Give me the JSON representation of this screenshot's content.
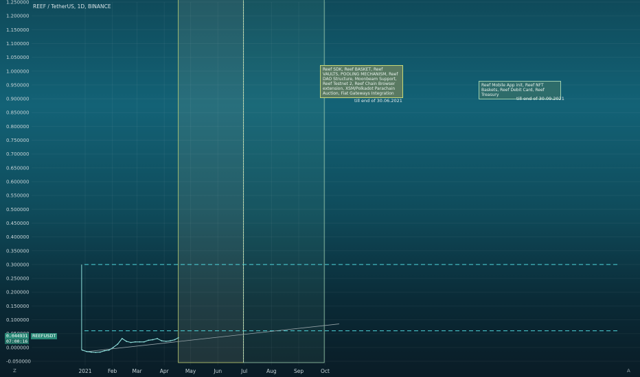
{
  "header": {
    "title": "REEF / TetherUS, 1D, BINANCE"
  },
  "price_tag": {
    "price": "0.044931",
    "countdown": "07:00:16",
    "symbol": "REEFUSDT"
  },
  "controls": {
    "left_corner": "Z",
    "right_corner": "A"
  },
  "annotations": [
    {
      "text": "Reef SDK, Reef BASKET, Reef VAULTS, POOLING MECHANISM, Reef DAO Structure, Moonbeam Support, Reef Testnet 2, Reef Chain Browser extension, XSM/Polkadot Parachain Auction, Fiat Gateways Integration",
      "caption": "till end of 30.06.2021"
    },
    {
      "text": "Reef Mobile App init, Reef NFT Baskets, Reef Debit Card, Reef Treasury",
      "caption": "till end of 30.09.2021"
    }
  ],
  "colors": {
    "zone1_border": "#c8d878",
    "zone2_border": "#9ed0b0",
    "dashed_line": "#4fd6dc",
    "price_line": "#8fe0dc",
    "trend_line": "#9aa6ab",
    "tag_bg": "#2a8a78"
  },
  "chart_data": {
    "type": "line",
    "title": "REEF / TetherUS, 1D, BINANCE",
    "xlabel": "",
    "ylabel": "",
    "x_ticks": [
      "2021",
      "Feb",
      "Mar",
      "Apr",
      "May",
      "Jun",
      "Jul",
      "Aug",
      "Sep",
      "Oct"
    ],
    "y_ticks": [
      "1.250000",
      "1.200000",
      "1.150000",
      "1.100000",
      "1.050000",
      "1.000000",
      "0.950000",
      "0.900000",
      "0.850000",
      "0.800000",
      "0.750000",
      "0.700000",
      "0.650000",
      "0.600000",
      "0.550000",
      "0.500000",
      "0.450000",
      "0.400000",
      "0.350000",
      "0.300000",
      "0.250000",
      "0.200000",
      "0.150000",
      "0.100000",
      "0.050000",
      "0.000000",
      "-0.050000"
    ],
    "ylim": [
      -0.05,
      1.25
    ],
    "series": [
      {
        "x": [
          "2020-12-29",
          "2021-01-03",
          "2021-01-08",
          "2021-01-13",
          "2021-01-18",
          "2021-01-23",
          "2021-01-28",
          "2021-02-02",
          "2021-02-07",
          "2021-02-12",
          "2021-02-17",
          "2021-02-22",
          "2021-02-27",
          "2021-03-04",
          "2021-03-09",
          "2021-03-14",
          "2021-03-19",
          "2021-03-24",
          "2021-03-29",
          "2021-04-03",
          "2021-04-08",
          "2021-04-13",
          "2021-04-17"
        ],
        "values": [
          -0.01,
          -0.015,
          -0.017,
          -0.018,
          -0.017,
          -0.012,
          -0.01,
          0.0,
          0.012,
          0.032,
          0.022,
          0.018,
          0.02,
          0.02,
          0.02,
          0.026,
          0.028,
          0.032,
          0.024,
          0.022,
          0.024,
          0.028,
          0.035
        ]
      }
    ],
    "zones": [
      {
        "start": "2021-04-17",
        "end": "2021-06-30",
        "caption": "till end of 30.06.2021"
      },
      {
        "start": "2021-06-30",
        "end": "2021-09-30",
        "caption": "till end of 30.09.2021"
      }
    ],
    "horizontal_levels": [
      0.3,
      0.06
    ],
    "spike": {
      "date": "2020-12-28",
      "high": 0.3,
      "low": -0.01
    },
    "trend_line": {
      "start": [
        "2021-01-03",
        -0.015
      ],
      "end": [
        "2021-10-17",
        0.085
      ]
    },
    "grid": true,
    "legend": "none"
  }
}
